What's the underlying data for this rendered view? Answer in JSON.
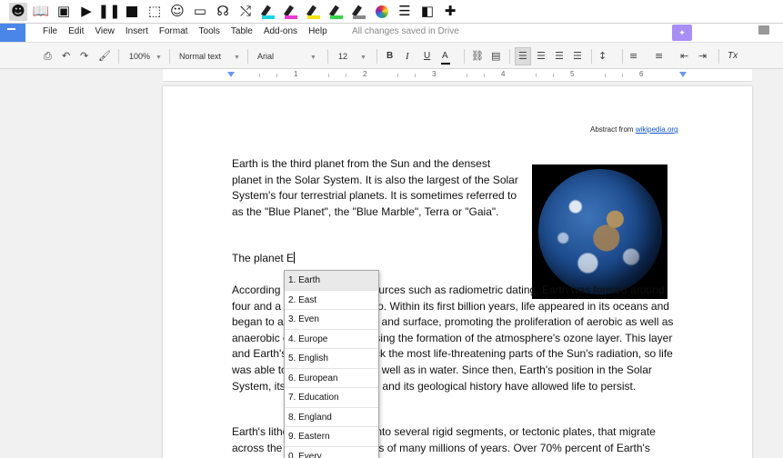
{
  "extension_toolbar": {
    "buttons": [
      {
        "icon": "speaker-head-icon",
        "glyph": "☻"
      },
      {
        "icon": "book-icon",
        "glyph": "📖"
      },
      {
        "icon": "picture-icon",
        "glyph": "▣"
      },
      {
        "icon": "play-icon",
        "glyph": "▶"
      },
      {
        "icon": "pause-icon",
        "glyph": "❚❚"
      },
      {
        "icon": "stop-icon",
        "glyph": ""
      },
      {
        "icon": "screen-select-icon",
        "glyph": "⬚"
      },
      {
        "icon": "speech-bubble-icon",
        "glyph": "☺"
      },
      {
        "icon": "monitor-icon",
        "glyph": "▭"
      },
      {
        "icon": "headphones-icon",
        "glyph": "☊"
      },
      {
        "icon": "shuffle-icon",
        "glyph": "⤭"
      },
      {
        "icon": "highlighter-cyan-icon",
        "ink": "#19d3e0"
      },
      {
        "icon": "highlighter-magenta-icon",
        "ink": "#e83bd8"
      },
      {
        "icon": "highlighter-yellow-icon",
        "ink": "#f3e21a"
      },
      {
        "icon": "highlighter-green-icon",
        "ink": "#36d34a"
      },
      {
        "icon": "highlighter-clear-icon",
        "ink": "#888888"
      },
      {
        "icon": "color-wheel-icon",
        "glyph": ""
      },
      {
        "icon": "list-icon",
        "glyph": "☰"
      },
      {
        "icon": "voice-note-icon",
        "glyph": "◧"
      },
      {
        "icon": "vocab-icon",
        "glyph": "✚"
      }
    ]
  },
  "menu": {
    "items": [
      "File",
      "Edit",
      "View",
      "Insert",
      "Format",
      "Tools",
      "Table",
      "Add-ons",
      "Help"
    ],
    "status": "All changes saved in Drive"
  },
  "format_toolbar": {
    "zoom": "100%",
    "style": "Normal text",
    "font": "Arial",
    "size": "12",
    "bold": "B",
    "italic": "I",
    "underline": "U",
    "text_color": "A",
    "clear": "Tx"
  },
  "ruler": {
    "numbers": [
      "1",
      "1",
      "2",
      "3",
      "4",
      "5",
      "6"
    ]
  },
  "document": {
    "abstract_prefix": "Abstract from",
    "abstract_link": "wikipedia.org",
    "paragraph1": "Earth is the third planet from the Sun and the densest planet in the Solar System. It is also the largest of the Solar System's four terrestrial planets. It is sometimes referred to as the \"Blue Planet\", the \"Blue Marble\", Terra or \"Gaia\".",
    "typing_line": "The planet E",
    "paragraph2": "According to evidence from sources such as radiometric dating, Earth was formed around four and a half billion years ago. Within its first billion years, life appeared in its oceans and began to affect its atmosphere and surface, promoting the proliferation of aerobic as well as anaerobic organisms and causing the formation of the atmosphere's ozone layer. This layer and Earth's magnetic field block the most life-threatening parts of the Sun's radiation, so life was able to flourish on land as well as in water. Since then, Earth's position in the Solar System, its physical properties and its geological history have allowed life to persist.",
    "paragraph3": "Earth's lithosphere is divided into several rigid segments, or tectonic plates, that migrate across the surface over periods of many millions of years. Over 70% percent of Earth's"
  },
  "autocomplete": {
    "items": [
      "1. Earth",
      "2. East",
      "3. Even",
      "4. Europe",
      "5. English",
      "6. European",
      "7. Education",
      "8. England",
      "9. Eastern",
      "0. Every"
    ]
  },
  "colors": {
    "accent": "#4a86e8",
    "extension_purple": "#a98ef5",
    "link": "#1155cc"
  }
}
